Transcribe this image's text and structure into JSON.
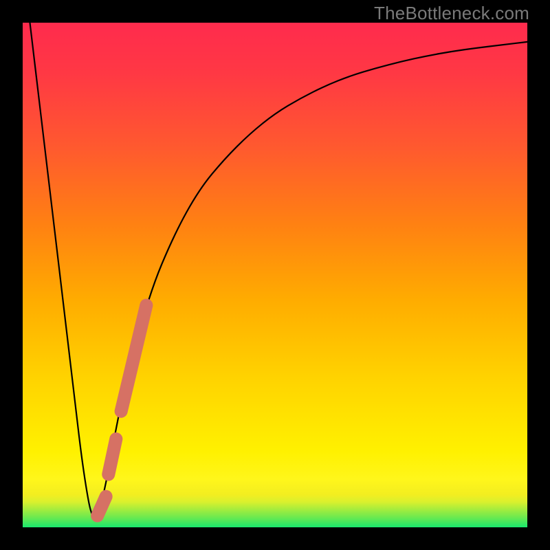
{
  "watermark": "TheBottleneck.com",
  "chart_data": {
    "type": "line",
    "title": "",
    "xlabel": "",
    "ylabel": "",
    "xlim": [
      0,
      100
    ],
    "ylim": [
      0,
      100
    ],
    "grid": false,
    "series": [
      {
        "name": "bottleneck-curve",
        "x": [
          0,
          5,
          10,
          12,
          14,
          16,
          18,
          20,
          25,
          30,
          35,
          40,
          45,
          50,
          55,
          60,
          65,
          70,
          75,
          80,
          85,
          90,
          95,
          100
        ],
        "y": [
          112,
          70,
          28,
          11,
          0,
          6,
          17,
          27,
          46,
          58,
          67,
          73,
          78,
          82,
          85,
          87.5,
          89.5,
          91,
          92.3,
          93.4,
          94.3,
          95,
          95.6,
          96.2
        ]
      }
    ],
    "annotations": [
      {
        "name": "salmon-marker-upper",
        "type": "capsule",
        "x1": 19.5,
        "y1": 23,
        "x2": 24.5,
        "y2": 44,
        "width_pct": 2.6,
        "color": "#d67164"
      },
      {
        "name": "salmon-marker-mid",
        "type": "capsule",
        "x1": 17.0,
        "y1": 10.5,
        "x2": 18.5,
        "y2": 17.5,
        "width_pct": 2.6,
        "color": "#d67164"
      },
      {
        "name": "salmon-marker-dot",
        "type": "capsule",
        "x1": 14.8,
        "y1": 2.3,
        "x2": 16.5,
        "y2": 6.1,
        "width_pct": 2.6,
        "color": "#d67164"
      }
    ],
    "gradient_bands": [
      {
        "y_pct": 0.0,
        "color": "#19e86e"
      },
      {
        "y_pct": 2.0,
        "color": "#6de94f"
      },
      {
        "y_pct": 3.5,
        "color": "#a3ec3e"
      },
      {
        "y_pct": 5.0,
        "color": "#d9f02e"
      },
      {
        "y_pct": 6.5,
        "color": "#f3ee20"
      },
      {
        "y_pct": 9.5,
        "color": "#fff61b"
      },
      {
        "y_pct": 15.0,
        "color": "#fff100"
      },
      {
        "y_pct": 30.0,
        "color": "#ffd200"
      },
      {
        "y_pct": 45.0,
        "color": "#ffac00"
      },
      {
        "y_pct": 60.0,
        "color": "#ff8112"
      },
      {
        "y_pct": 75.0,
        "color": "#ff5a2e"
      },
      {
        "y_pct": 90.0,
        "color": "#ff3844"
      },
      {
        "y_pct": 100.0,
        "color": "#ff2b4d"
      }
    ]
  }
}
